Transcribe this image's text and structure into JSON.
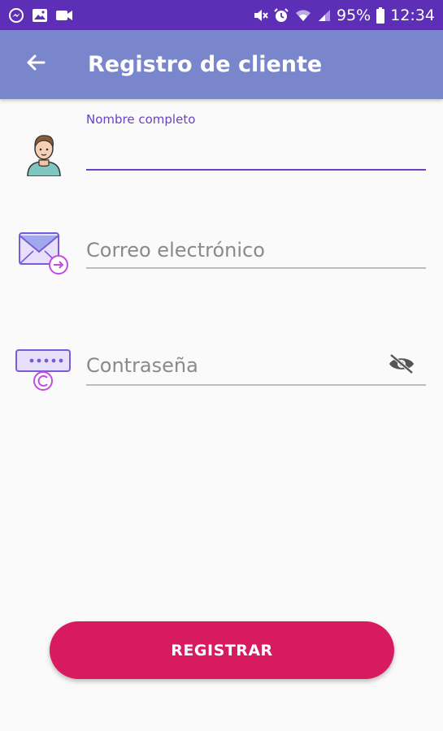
{
  "status_bar": {
    "left_icons": [
      "messenger-icon",
      "gallery-icon",
      "video-icon"
    ],
    "right_icons": [
      "mute-icon",
      "alarm-icon",
      "wifi-icon",
      "signal-icon",
      "battery-icon"
    ],
    "battery": "95%",
    "time": "12:34"
  },
  "app_bar": {
    "title": "Registro de cliente",
    "back_icon": "arrow-left-icon",
    "color": "#7986cb"
  },
  "form": {
    "name": {
      "label": "Nombre completo",
      "value": "",
      "icon": "user-avatar-icon"
    },
    "email": {
      "placeholder": "Correo electrónico",
      "value": "",
      "icon": "email-icon"
    },
    "password": {
      "placeholder": "Contraseña",
      "value": "",
      "icon": "password-icon",
      "toggle_icon": "eye-off-icon"
    }
  },
  "register_button": {
    "label": "REGISTRAR",
    "color": "#d81b60"
  },
  "colors": {
    "status_bar": "#5c2fb6",
    "accent": "#6a42c2"
  }
}
